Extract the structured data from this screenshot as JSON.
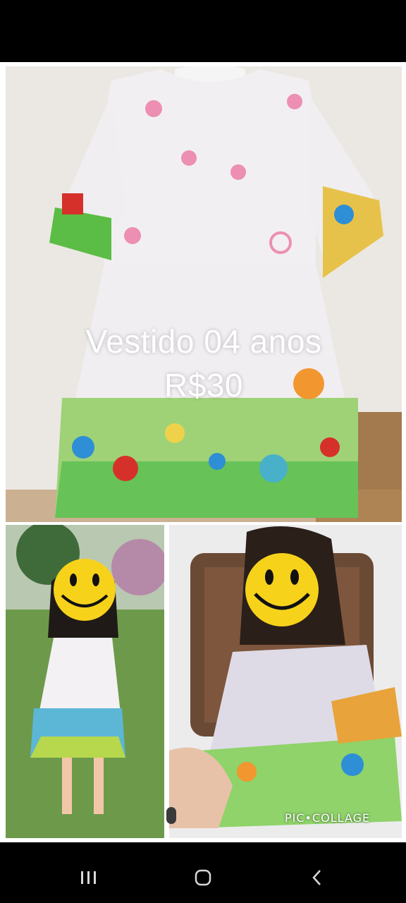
{
  "listing": {
    "title": "Vestido 04 anos",
    "price": "R$30"
  },
  "collage": {
    "watermark": "PIC•COLLAGE",
    "photos": [
      "dress-on-hanger",
      "child-outdoors",
      "child-seated"
    ]
  },
  "navigation": {
    "icons": [
      "recents-icon",
      "home-icon",
      "back-icon"
    ]
  },
  "colors": {
    "background": "#000000",
    "collage_border": "#ffffff",
    "text": "#ffffff",
    "emoji_yellow": "#f7d21b"
  }
}
